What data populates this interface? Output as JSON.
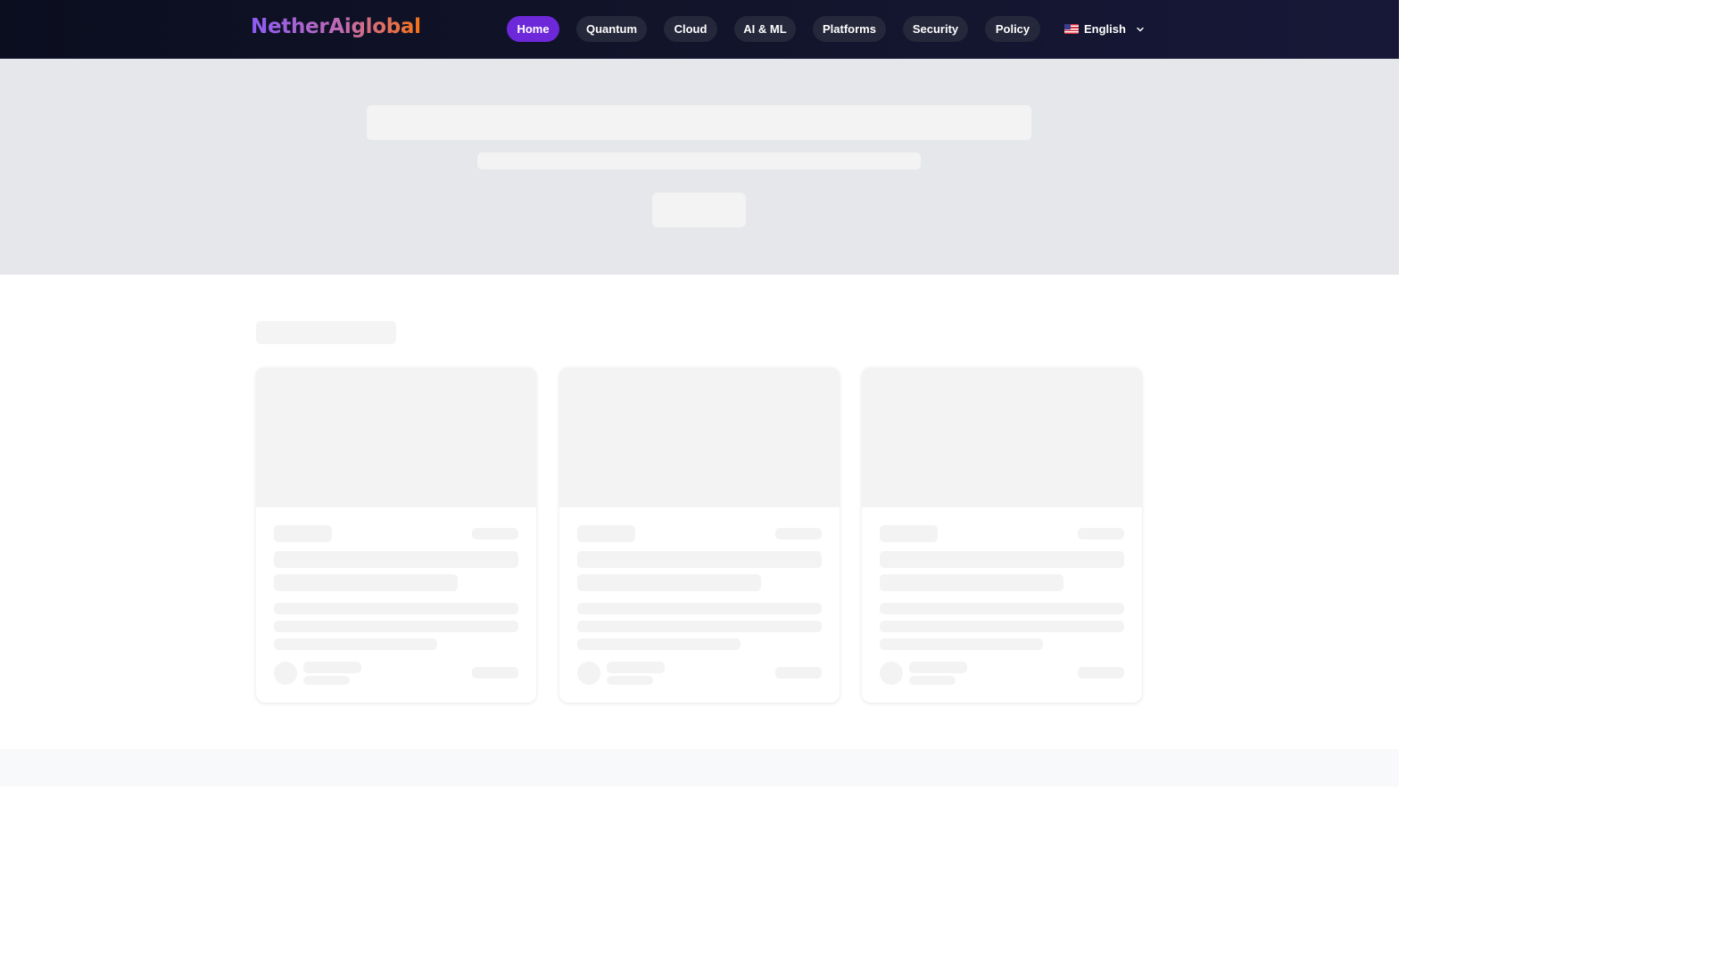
{
  "brand": {
    "logo_text": "NetherAiglobal"
  },
  "nav": {
    "items": [
      {
        "label": "Home",
        "active": true
      },
      {
        "label": "Quantum",
        "active": false
      },
      {
        "label": "Cloud",
        "active": false
      },
      {
        "label": "AI & ML",
        "active": false
      },
      {
        "label": "Platforms",
        "active": false
      },
      {
        "label": "Security",
        "active": false
      },
      {
        "label": "Policy",
        "active": false
      }
    ],
    "language": {
      "label": "English",
      "flag_icon": "us-flag-icon",
      "chevron_icon": "chevron-down-icon"
    }
  },
  "colors": {
    "header_bg": "#12142b",
    "accent_active": "#6d28d9",
    "pill_bg": "#25273a",
    "skeleton": "#f3f3f3",
    "hero_bg": "#e5e7eb"
  },
  "state": {
    "loading": true
  }
}
